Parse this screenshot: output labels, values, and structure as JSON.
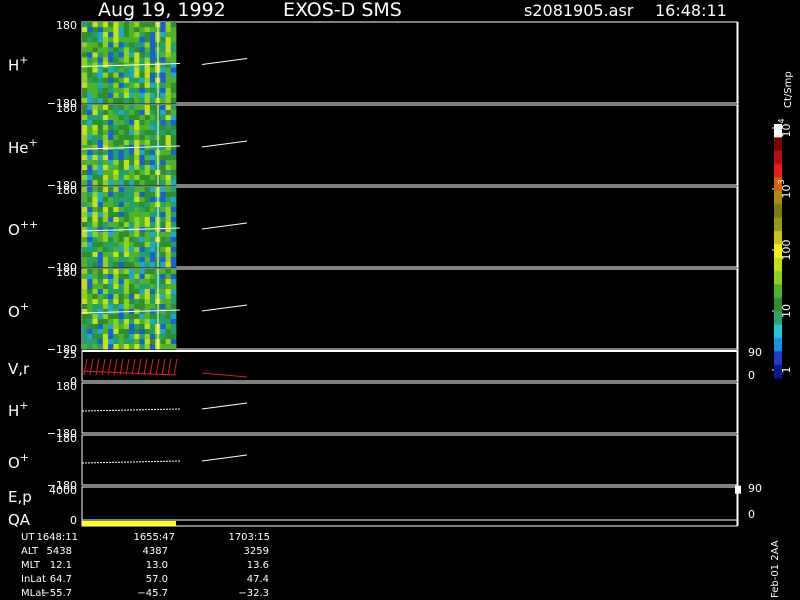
{
  "header": {
    "date": "Aug 19, 1992",
    "instrument": "EXOS-D SMS",
    "file": "s2081905.asr",
    "time": "16:48:11"
  },
  "chart_data": {
    "type": "heatmap",
    "panels": [
      {
        "label": "H",
        "superscript": "+",
        "ytop": "180",
        "ybot": "−180",
        "kind": "spectrogram"
      },
      {
        "label": "He",
        "superscript": "+",
        "ytop": "180",
        "ybot": "−180",
        "kind": "spectrogram"
      },
      {
        "label": "O",
        "superscript": "++",
        "ytop": "180",
        "ybot": "−180",
        "kind": "spectrogram"
      },
      {
        "label": "O",
        "superscript": "+",
        "ytop": "180",
        "ybot": "−180",
        "kind": "spectrogram"
      },
      {
        "label": "V,r",
        "superscript": "",
        "ytop": "25",
        "ybot": "0",
        "rtop": "90",
        "rbot": "0",
        "kind": "line"
      },
      {
        "label": "H",
        "superscript": "+",
        "ytop": "180",
        "ybot": "−180",
        "kind": "line"
      },
      {
        "label": "O",
        "superscript": "+",
        "ytop": "180",
        "ybot": "−180",
        "kind": "line"
      },
      {
        "label": "E,p",
        "superscript": "",
        "ytop": "4000",
        "ybot": "0",
        "rtop": "90",
        "rbot": "0",
        "kind": "line"
      },
      {
        "label": "QA",
        "superscript": "",
        "kind": "flag"
      }
    ],
    "colorbar": {
      "title": "Ct/Smp",
      "tick_labels": [
        "1",
        "10",
        "100",
        "10",
        "10"
      ],
      "tick_exponents": [
        "",
        "",
        "",
        "3",
        "4"
      ],
      "colors": [
        "#0a1a8a",
        "#1d3fc8",
        "#1c8fe0",
        "#22c7d6",
        "#2ca36e",
        "#2f8f2f",
        "#4fb22a",
        "#8ed21f",
        "#c4e01a",
        "#f2f21a",
        "#c8c21a",
        "#9a9a18",
        "#7a7a14",
        "#b08a12",
        "#d46010",
        "#e02010",
        "#b01010",
        "#7a0000",
        "#ffffff"
      ]
    },
    "slider_fraction": 0.92,
    "footer_table": {
      "rows": [
        {
          "label": "UT",
          "values": [
            "1648:11",
            "1655:47",
            "1703:15"
          ]
        },
        {
          "label": "ALT",
          "values": [
            "5438",
            "4387",
            "3259"
          ]
        },
        {
          "label": "MLT",
          "values": [
            "12.1",
            "13.0",
            "13.6"
          ]
        },
        {
          "label": "InLat",
          "values": [
            "64.7",
            "57.0",
            "47.4"
          ]
        },
        {
          "label": "MLat",
          "values": [
            "−55.7",
            "−45.7",
            "−32.3"
          ]
        }
      ]
    },
    "side_note": "Feb-01 2AA"
  }
}
